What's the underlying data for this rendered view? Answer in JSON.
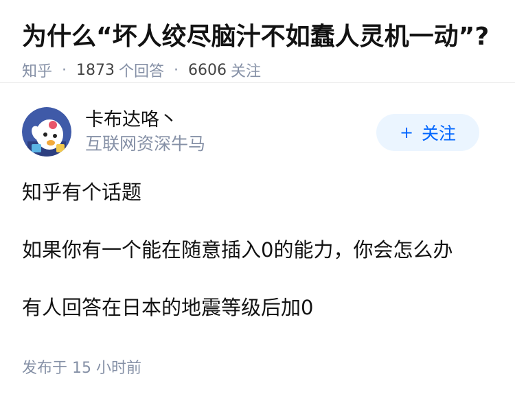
{
  "question": {
    "title": "为什么“坏人绞尽脑汁不如蠢人灵机一动”?",
    "source": "知乎",
    "answer_count": "1873",
    "answer_label": "个回答",
    "follow_count": "6606",
    "follow_label": "关注"
  },
  "answer": {
    "author_name": "卡布达咯丶",
    "author_headline": "互联网资深牛马",
    "follow_button": "关注",
    "paragraphs": [
      "知乎有个话题",
      "如果你有一个能在随意插入0的能力，你会怎么办",
      "有人回答在日本的地震等级后加0"
    ],
    "posted_label": "发布于",
    "posted_time": "15 小时前"
  },
  "colors": {
    "accent": "#0066ff",
    "button_bg": "#ebf5ff",
    "meta": "#8590a6",
    "avatar_bg": "#3f5aa8"
  }
}
